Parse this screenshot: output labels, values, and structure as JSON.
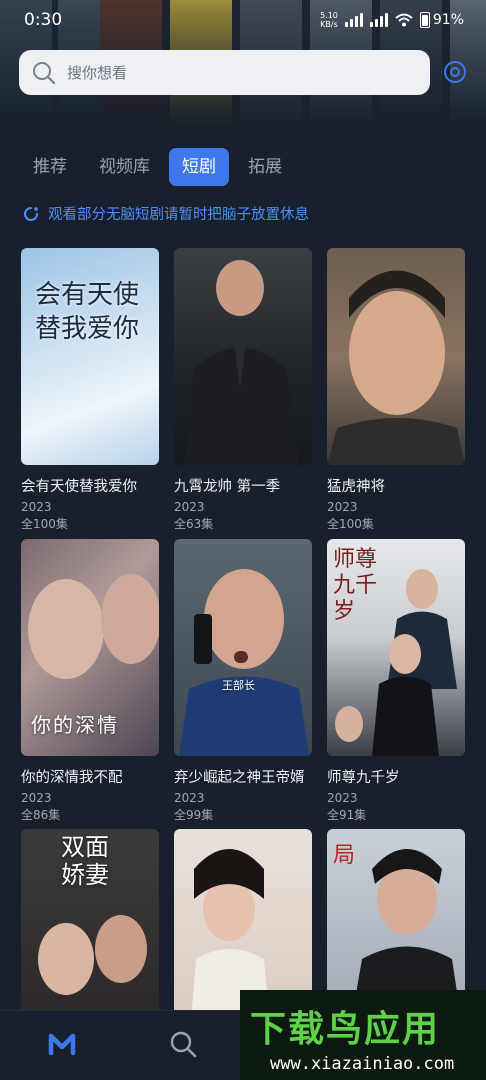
{
  "status_bar": {
    "time": "0:30",
    "net_speed_value": "5.10",
    "net_speed_unit": "KB/s",
    "battery": "91%"
  },
  "search": {
    "placeholder": "搜你想看"
  },
  "tabs": [
    {
      "label": "推荐",
      "active": false
    },
    {
      "label": "视频库",
      "active": false
    },
    {
      "label": "短剧",
      "active": true
    },
    {
      "label": "拓展",
      "active": false
    }
  ],
  "notice": {
    "text": "观看部分无脑短剧请暂时把脑子放置休息"
  },
  "dramas": [
    {
      "title": "会有天使替我爱你",
      "year": "2023",
      "episodes": "全100集",
      "poster_text": "会有天使替我爱你"
    },
    {
      "title": "九霄龙帅 第一季",
      "year": "2023",
      "episodes": "全63集"
    },
    {
      "title": "猛虎神将",
      "year": "2023",
      "episodes": "全100集"
    },
    {
      "title": "你的深情我不配",
      "year": "2023",
      "episodes": "全86集",
      "poster_text": "你的深情"
    },
    {
      "title": "弃少崛起之神王帝婿",
      "year": "2023",
      "episodes": "全99集",
      "poster_text": "王部长"
    },
    {
      "title": "师尊九千岁",
      "year": "2023",
      "episodes": "全91集",
      "poster_text": "师尊九千岁"
    },
    {
      "title": "",
      "year": "",
      "episodes": "",
      "poster_text": "双面娇妻"
    },
    {
      "title": "",
      "year": "",
      "episodes": ""
    },
    {
      "title": "",
      "year": "",
      "episodes": "",
      "poster_text": "局"
    }
  ],
  "bottom_nav": [
    {
      "icon": "home-m-icon",
      "active": true
    },
    {
      "icon": "search-icon",
      "active": false
    }
  ],
  "watermark": {
    "main": "下载鸟应用",
    "sub": "www.xiazainiao.com"
  },
  "colors": {
    "background": "#17202c",
    "accent": "#3f78ec",
    "notice": "#4f8ef5",
    "watermark_green": "#5fd24a"
  }
}
